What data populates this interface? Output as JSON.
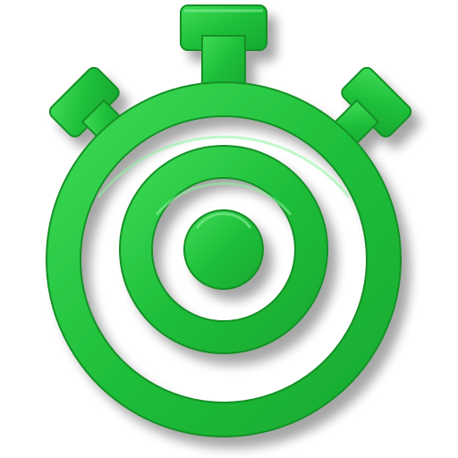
{
  "icon": {
    "name": "stopwatch-target-icon",
    "colors": {
      "fill": "#1fbf3a",
      "highlight": "#7ff090",
      "edge": "#0f8f25",
      "shadow": "#000000",
      "background": "#ffffff"
    }
  }
}
